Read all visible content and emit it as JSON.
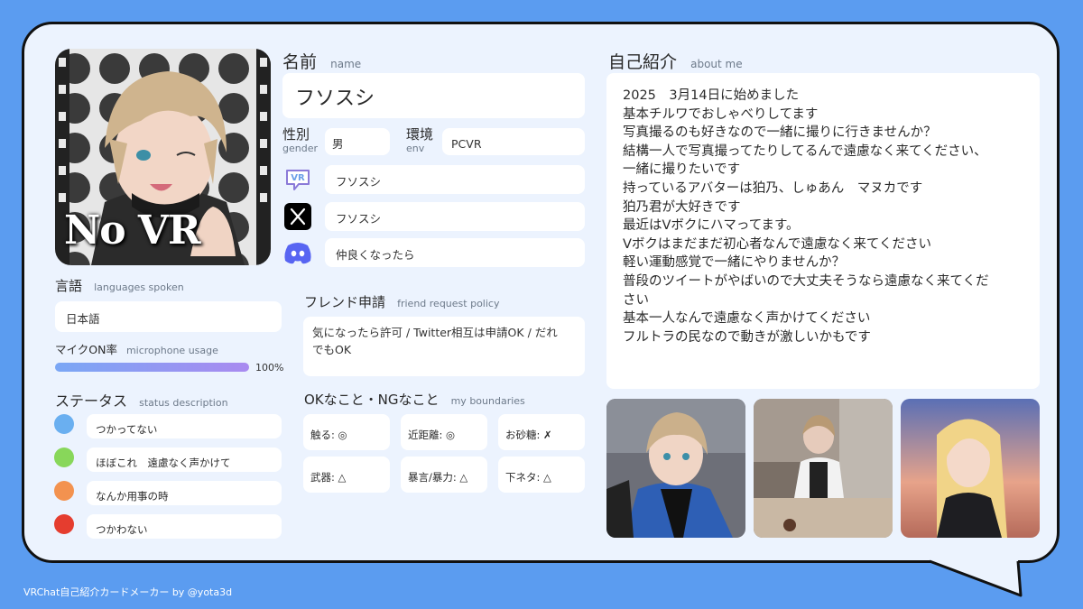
{
  "name": {
    "label_jp": "名前",
    "label_en": "name",
    "value": "フソスシ"
  },
  "gender": {
    "label_jp": "性別",
    "label_en": "gender",
    "value": "男"
  },
  "env": {
    "label_jp": "環境",
    "label_en": "env",
    "value": "PCVR"
  },
  "socials": [
    {
      "icon": "vrchat-icon",
      "value": "フソスシ"
    },
    {
      "icon": "x-icon",
      "value": "フソスシ"
    },
    {
      "icon": "discord-icon",
      "value": "仲良くなったら"
    }
  ],
  "avatar_overlay_text": "No VR",
  "languages": {
    "label_jp": "言語",
    "label_en": "languages spoken",
    "value": "日本語"
  },
  "mic": {
    "label_jp": "マイクON率",
    "label_en": "microphone usage",
    "percent": 100,
    "percent_text": "100%"
  },
  "status": {
    "label_jp": "ステータス",
    "label_en": "status description",
    "items": [
      {
        "color": "#6aaff0",
        "text": "つかってない"
      },
      {
        "color": "#88d75a",
        "text": "ほぼこれ　遠慮なく声かけて"
      },
      {
        "color": "#f3924f",
        "text": "なんか用事の時"
      },
      {
        "color": "#e53d2f",
        "text": "つかわない"
      }
    ]
  },
  "friend": {
    "label_jp": "フレンド申請",
    "label_en": "friend request policy",
    "value_lines": [
      "気になったら許可 / Twitter相互は申請OK / だれ",
      "でもOK"
    ]
  },
  "boundaries": {
    "label_jp": "OKなこと・NGなこと",
    "label_en": "my boundaries",
    "items": [
      "触る: ◎",
      "近距離: ◎",
      "お砂糖: ✗",
      "武器: △",
      "暴言/暴力: △",
      "下ネタ: △"
    ]
  },
  "about": {
    "label_jp": "自己紹介",
    "label_en": "about me",
    "lines": [
      "2025　3月14日に始めました",
      "基本チルワでおしゃべりしてます",
      "写真撮るのも好きなので一緒に撮りに行きませんか？",
      "結構一人で写真撮ってたりしてるんで遠慮なく来てください、",
      "一緒に撮りたいです",
      "持っているアバターは狛乃、しゅあん　マヌカです",
      "狛乃君が大好きです",
      "最近はVボクにハマってます。",
      "Vボクはまだまだ初心者なんで遠慮なく来てください",
      "軽い運動感覚で一緒にやりませんか？",
      "普段のツイートがやばいので大丈夫そうなら遠慮なく来てくだ",
      "さい",
      "基本一人なんで遠慮なく声かけてください",
      "フルトラの民なので動きが激しいかもです"
    ]
  },
  "footer": "VRChat自己紹介カードメーカー by @yota3d",
  "colors": {
    "background": "#5b9cf0",
    "card": "#ecf3fe",
    "mic_bar_start": "#7aa7f5",
    "mic_bar_end": "#a98af0"
  }
}
